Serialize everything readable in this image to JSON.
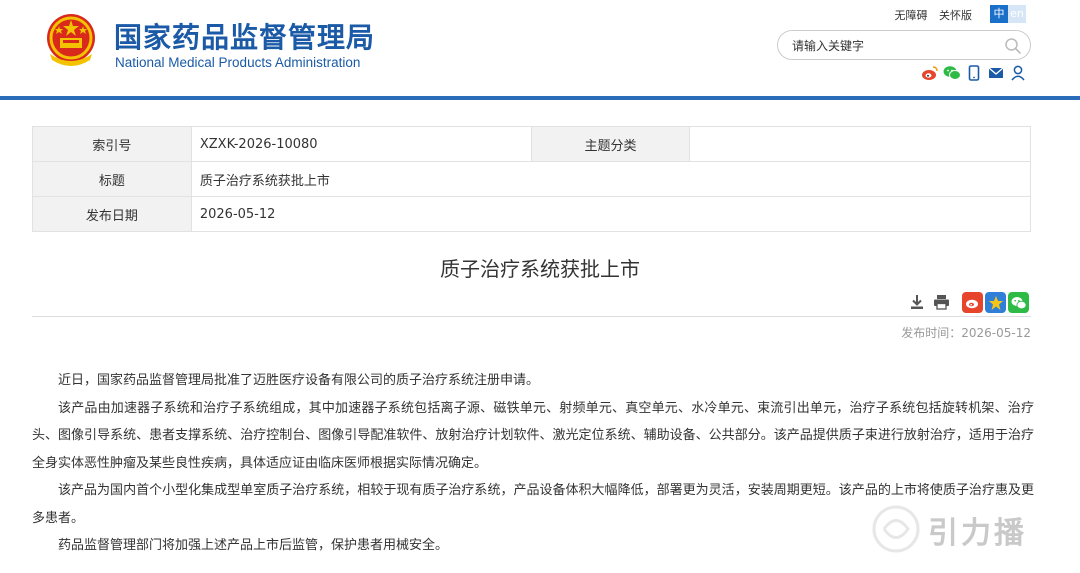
{
  "header": {
    "site_name_cn": "国家药品监督管理局",
    "site_name_en": "National Medical Products Administration",
    "links": {
      "accessibility": "无障碍",
      "elder_mode": "关怀版"
    },
    "lang": {
      "cn": "中",
      "en": "en"
    },
    "search": {
      "placeholder": "请输入关键字"
    },
    "social_icons": [
      "weibo-icon",
      "wechat-icon",
      "mobile-icon",
      "mail-icon",
      "user-icon"
    ]
  },
  "meta": {
    "index_label": "索引号",
    "index_value": "XZXK-2026-10080",
    "topic_label": "主题分类",
    "topic_value": "",
    "title_label": "标题",
    "title_value": "质子治疗系统获批上市",
    "date_label": "发布日期",
    "date_value": "2026-05-12"
  },
  "article": {
    "title": "质子治疗系统获批上市",
    "publish_time": "发布时间：2026-05-12",
    "paragraphs": [
      "近日，国家药品监督管理局批准了迈胜医疗设备有限公司的质子治疗系统注册申请。",
      "该产品由加速器子系统和治疗子系统组成，其中加速器子系统包括离子源、磁铁单元、射频单元、真空单元、水冷单元、束流引出单元，治疗子系统包括旋转机架、治疗头、图像引导系统、患者支撑系统、治疗控制台、图像引导配准软件、放射治疗计划软件、激光定位系统、辅助设备、公共部分。该产品提供质子束进行放射治疗，适用于治疗全身实体恶性肿瘤及某些良性疾病，具体适应证由临床医师根据实际情况确定。",
      "该产品为国内首个小型化集成型单室质子治疗系统，相较于现有质子治疗系统，产品设备体积大幅降低，部署更为灵活，安装周期更短。该产品的上市将使质子治疗惠及更多患者。",
      "药品监督管理部门将加强上述产品上市后监管，保护患者用械安全。"
    ]
  },
  "watermark": {
    "text": "引力播"
  },
  "colors": {
    "brand_blue": "#1a5aa6",
    "rule_blue": "#2b6cb8",
    "weibo": "#e6452c",
    "star": "#2f7fd8",
    "wechat": "#2dbb45"
  }
}
